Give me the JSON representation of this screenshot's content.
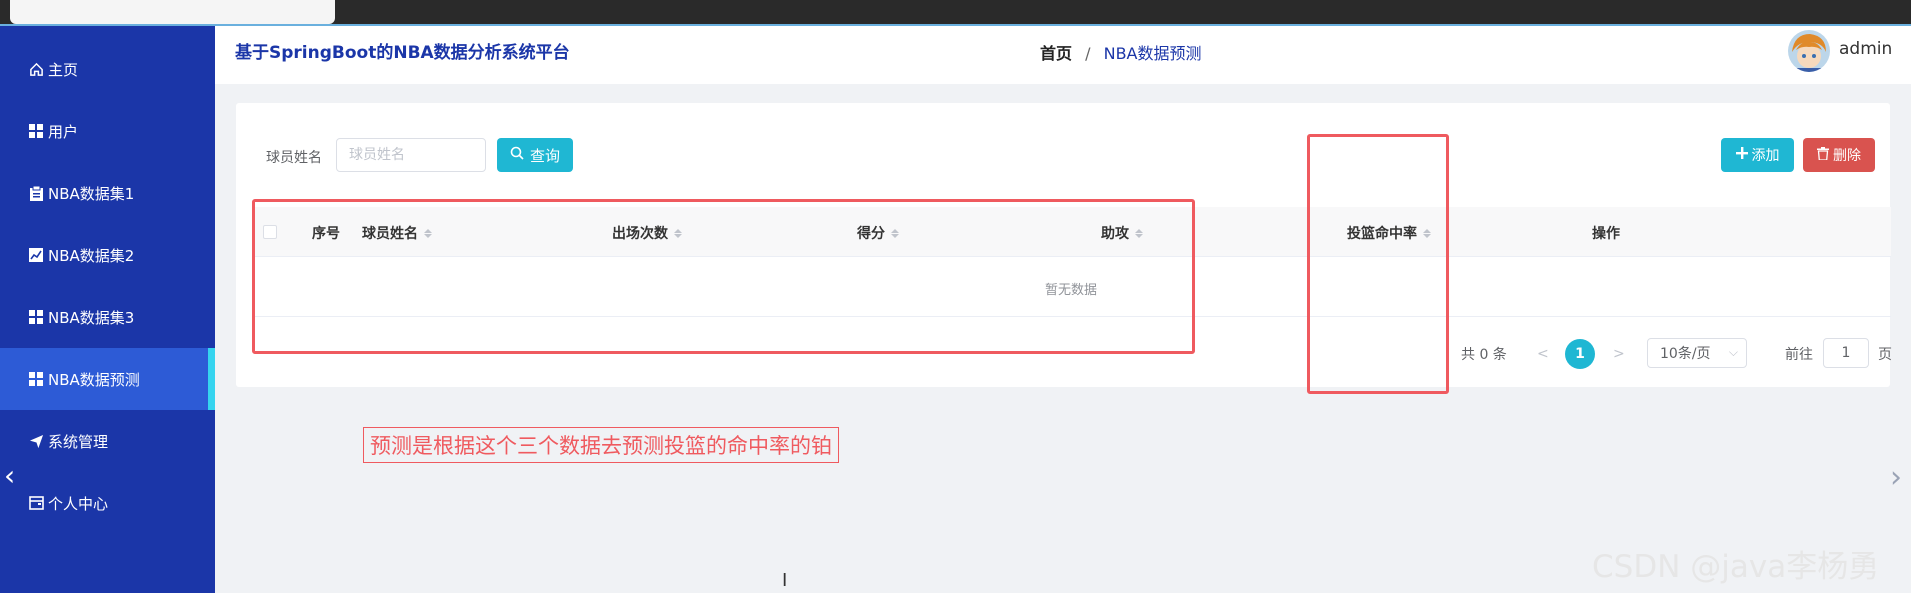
{
  "app": {
    "title": "基于SpringBoot的NBA数据分析系统平台",
    "username": "admin"
  },
  "breadcrumb": {
    "home": "首页",
    "separator": "/",
    "current": "NBA数据预测"
  },
  "sidebar": {
    "items": [
      {
        "label": "主页",
        "icon": "home-icon"
      },
      {
        "label": "用户",
        "icon": "grid-icon"
      },
      {
        "label": "NBA数据集1",
        "icon": "clipboard-icon"
      },
      {
        "label": "NBA数据集2",
        "icon": "chart-icon"
      },
      {
        "label": "NBA数据集3",
        "icon": "grid-icon"
      },
      {
        "label": "NBA数据预测",
        "icon": "grid-icon",
        "active": true
      },
      {
        "label": "系统管理",
        "icon": "send-icon"
      },
      {
        "label": "个人中心",
        "icon": "wallet-icon"
      }
    ]
  },
  "search": {
    "label": "球员姓名",
    "placeholder": "球员姓名",
    "query_button": "查询"
  },
  "toolbar": {
    "add_button": "添加",
    "delete_button": "删除"
  },
  "table": {
    "columns": [
      "序号",
      "球员姓名",
      "出场次数",
      "得分",
      "助攻",
      "投篮命中率",
      "操作"
    ],
    "empty_text": "暂无数据"
  },
  "pagination": {
    "total": "共 0 条",
    "prev": "<",
    "current_page": "1",
    "next": ">",
    "page_size": "10条/页",
    "goto_label": "前往",
    "goto_value": "1",
    "page_suffix": "页"
  },
  "annotation": {
    "note": "预测是根据这个三个数据去预测投篮的命中率的铂"
  },
  "watermark": "CSDN @java李杨勇",
  "colors": {
    "sidebar_bg": "#1b36a8",
    "sidebar_active": "#2d5bd6",
    "accent": "#1fb7d3",
    "danger": "#d9534f",
    "annotation_red": "#ef5a5f"
  }
}
